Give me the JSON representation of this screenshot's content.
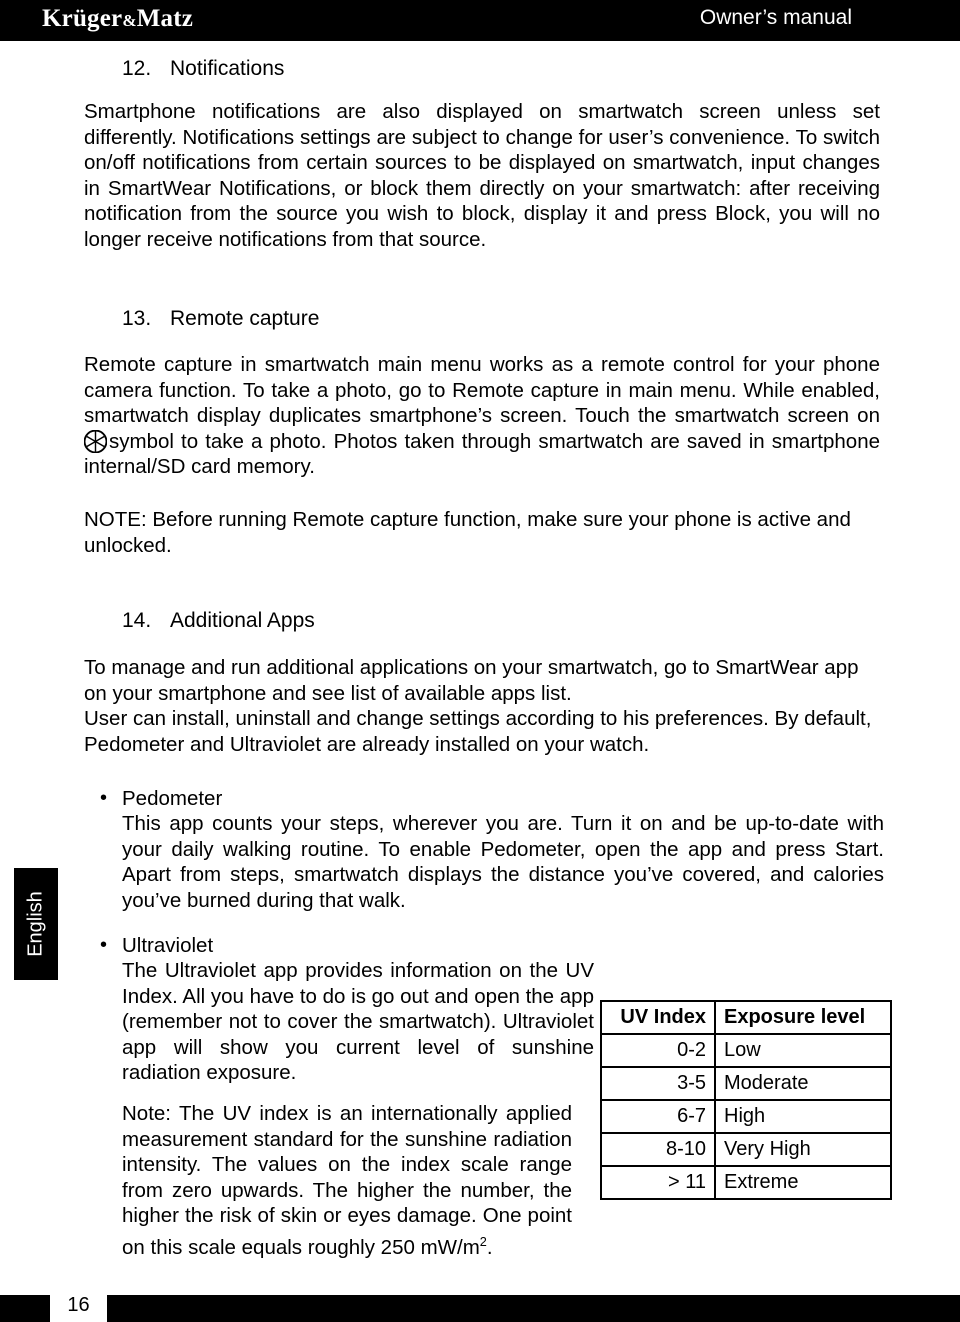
{
  "header": {
    "brand_first": "Krüger",
    "brand_amp": "&",
    "brand_last": "Matz",
    "right_label": "Owner’s manual"
  },
  "sections": [
    {
      "number": "12.",
      "title": "Notifications",
      "body": "Smartphone notifications are also displayed on smartwatch screen unless set differently. Notifications settings are subject to change for user’s convenience. To switch on/off notifications from certain sources to be displayed on smartwatch, input changes in SmartWear Notifications, or block them directly on your smartwatch: after receiving notification from the source you wish to block, display it and press Block, you will no longer receive notifications from that source."
    },
    {
      "number": "13.",
      "title": "Remote capture",
      "body_before_icon": "Remote capture in smartwatch main menu works as a remote control for your phone camera function. To take a photo, go to Remote capture in main menu. While enabled, smartwatch display duplicates smartphone’s screen. Touch the smartwatch screen on ",
      "icon": "camera-aperture-icon",
      "body_after_icon": "symbol to take a photo. Photos taken through smartwatch are saved in smartphone internal/SD card memory.",
      "note": "NOTE: Before running Remote capture function, make sure your phone is active and unlocked."
    },
    {
      "number": "14.",
      "title": "Additional Apps",
      "body_1": "To manage and run additional applications on your smartwatch, go to SmartWear app on your smartphone and see list of available apps list.",
      "body_2": "User can install, uninstall and change settings according to his preferences. By default, Pedometer and Ultraviolet are already installed on your watch."
    }
  ],
  "apps": {
    "bullet_char": "•",
    "items": [
      {
        "name": "Pedometer",
        "description": "This app counts your steps, wherever you are. Turn it on and be up-to-date with your daily walking routine. To enable Pedometer, open the app and press Start. Apart from steps, smartwatch displays the distance you’ve covered, and calories you’ve burned during that walk."
      },
      {
        "name": "Ultraviolet",
        "description": "The Ultraviolet app provides information on the UV Index. All you have to do is go out and open the app (remember not to cover the smartwatch). Ultraviolet app will show you current level of sunshine radiation exposure."
      }
    ]
  },
  "uv_note": {
    "text_before_sup": "Note: The UV index is an internationally applied measurement standard for the sunshine radiation intensity. The values on the index scale range from zero upwards. The higher the number, the higher the risk of skin or eyes damage. One point on this scale equals roughly 250 mW/m",
    "superscript": "2",
    "text_after_sup": "."
  },
  "uv_table": {
    "headers": [
      "UV Index",
      "Exposure level"
    ],
    "rows": [
      [
        "0-2",
        "Low"
      ],
      [
        "3-5",
        "Moderate"
      ],
      [
        "6-7",
        "High"
      ],
      [
        "8-10",
        "Very High"
      ],
      [
        "> 11",
        "Extreme"
      ]
    ]
  },
  "language_tab": {
    "label": "English"
  },
  "footer": {
    "page_number": "16"
  },
  "colors": {
    "bar": "#000000",
    "page": "#ffffff",
    "text": "#000000"
  }
}
